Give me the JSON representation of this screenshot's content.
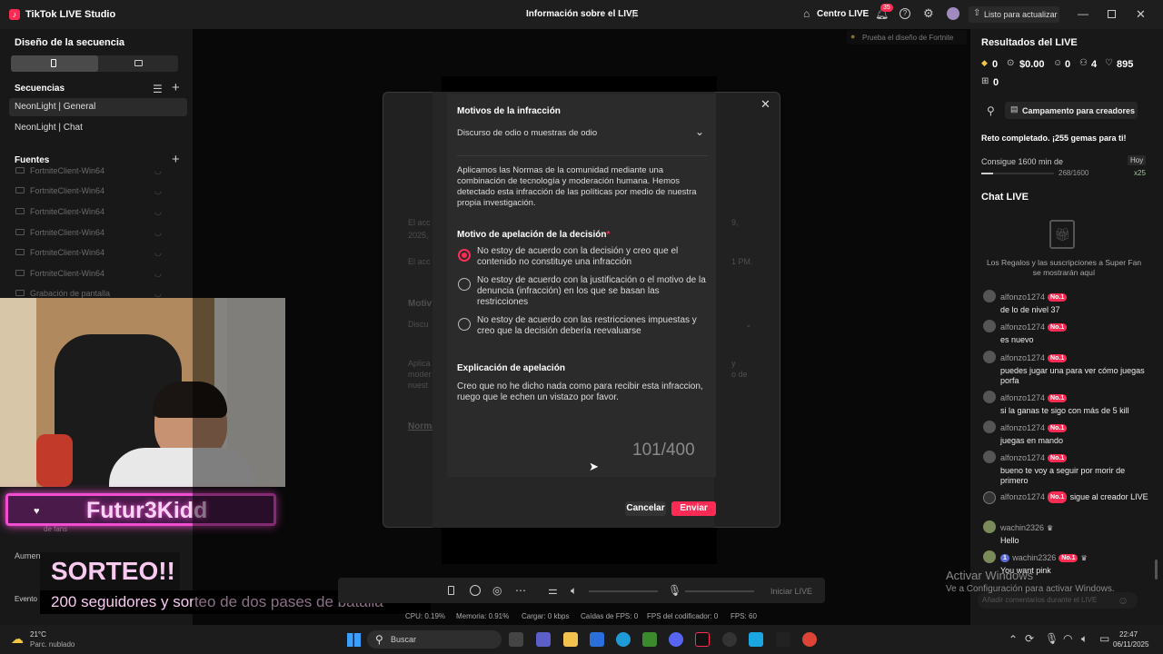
{
  "titlebar": {
    "app_name": "TikTok LIVE Studio",
    "center_title": "Información sobre el LIVE",
    "centro_live": "Centro LIVE",
    "notif_count": "35",
    "update_label": "Listo para actualizar"
  },
  "left": {
    "sequence_title": "Diseño de la secuencia",
    "sequences_title": "Secuencias",
    "sequences": [
      "NeonLight | General",
      "NeonLight | Chat"
    ],
    "sources_title": "Fuentes",
    "sources": [
      "FortniteClient-Win64",
      "FortniteClient-Win64",
      "FortniteClient-Win64",
      "FortniteClient-Win64",
      "FortniteClient-Win64",
      "FortniteClient-Win64",
      "Grabación de pantalla"
    ],
    "bottom_a": "Aumen",
    "bottom_b": "Evento",
    "bottom_c": "de fans"
  },
  "overlay": {
    "name": "Futur3Kidd",
    "sorteo": "SORTEO!!",
    "promo": "200 seguidores y sorteo de dos pases de batalla"
  },
  "center": {
    "fortnite_tip": "Prueba el diseño de Fortnite",
    "ghost": {
      "line1": "El acc",
      "line2": "2025,",
      "line3": "El acc",
      "r1": "9,",
      "r2": "1 PM.",
      "mot": "Motiv",
      "disc": "Discu",
      "apl1": "Aplica",
      "apl2": "moder",
      "apl3": "nuest",
      "r3": "y",
      "r4": "o de",
      "norma": "Norma"
    }
  },
  "modal": {
    "infraction_title": "Motivos de la infracción",
    "infraction_value": "Discurso de odio o muestras de odio",
    "info_text": "Aplicamos las Normas de la comunidad mediante una combinación de tecnología y moderación humana. Hemos detectado esta infracción de las políticas por medio de nuestra propia investigación.",
    "appeal_reason_title": "Motivo de apelación de la decisión",
    "required_mark": "*",
    "options": [
      "No estoy de acuerdo con la decisión y creo que el contenido no constituye una infracción",
      "No estoy de acuerdo con la justificación o el motivo de la denuncia (infracción) en los que se basan las restricciones",
      "No estoy de acuerdo con las restricciones impuestas y creo que la decisión debería reevaluarse"
    ],
    "selected_option": 0,
    "explanation_title": "Explicación de apelación",
    "explanation_text": "Creo que no he dicho nada como para recibir esta infraccion, ruego que le echen un vistazo por favor.",
    "char_count": "101/400",
    "cancel_label": "Cancelar",
    "submit_label": "Enviar"
  },
  "toolbar": {
    "start_live": "Iniciar LIVE"
  },
  "status": {
    "cpu": "CPU: 0.19%",
    "memory": "Memoria: 0.91%",
    "upload": "Cargar: 0 kbps",
    "fps_drops": "Caídas de FPS: 0",
    "encoder_fps": "FPS del codificador: 0",
    "fps": "FPS: 60"
  },
  "right": {
    "results_title": "Resultados del LIVE",
    "stats": [
      "0",
      "$0.00",
      "0",
      "4",
      "895",
      "0"
    ],
    "camp_label": "Campamento para creadores",
    "challenge": "Reto completado. ¡255 gemas para ti!",
    "goal": "Consigue 1600 min de",
    "goal_today": "Hoy",
    "goal_progress": "268/1600",
    "goal_progress_fraction": 0.1675,
    "goal_reward": "x25",
    "chat_title": "Chat LIVE",
    "gifts_note": "Los Regalos y las suscripciones a Super Fan se mostrarán aquí",
    "comment_placeholder": "Añadir comentarios durante el LIVE",
    "chat": [
      {
        "user": "alfonzo1274",
        "badge": "No.1",
        "msg": "de lo de nivel 37"
      },
      {
        "user": "alfonzo1274",
        "badge": "No.1",
        "msg": "es nuevo"
      },
      {
        "user": "alfonzo1274",
        "badge": "No.1",
        "msg": "puedes jugar una para ver cómo juegas porfa"
      },
      {
        "user": "alfonzo1274",
        "badge": "No.1",
        "msg": "si la ganas te sigo con más de 5 kill"
      },
      {
        "user": "alfonzo1274",
        "badge": "No.1",
        "msg": "juegas en mando"
      },
      {
        "user": "alfonzo1274",
        "badge": "No.1",
        "msg": "bueno te voy a seguir por morir de primero"
      },
      {
        "user": "alfonzo1274",
        "badge": "No.1",
        "msg": "sigue al creador LIVE"
      },
      {
        "user": "wachin2326",
        "badge": "",
        "msg": "Hello"
      },
      {
        "user": "wachin2326",
        "badge": "No.1",
        "level": "1",
        "msg": "You want pink"
      }
    ]
  },
  "watermark": {
    "line1": "Activar Windows",
    "line2": "Ve a Configuración para activar Windows."
  },
  "taskbar": {
    "temp": "21°C",
    "weather": "Parc. nublado",
    "search": "Buscar",
    "time": "22:47",
    "date": "06/11/2025"
  }
}
